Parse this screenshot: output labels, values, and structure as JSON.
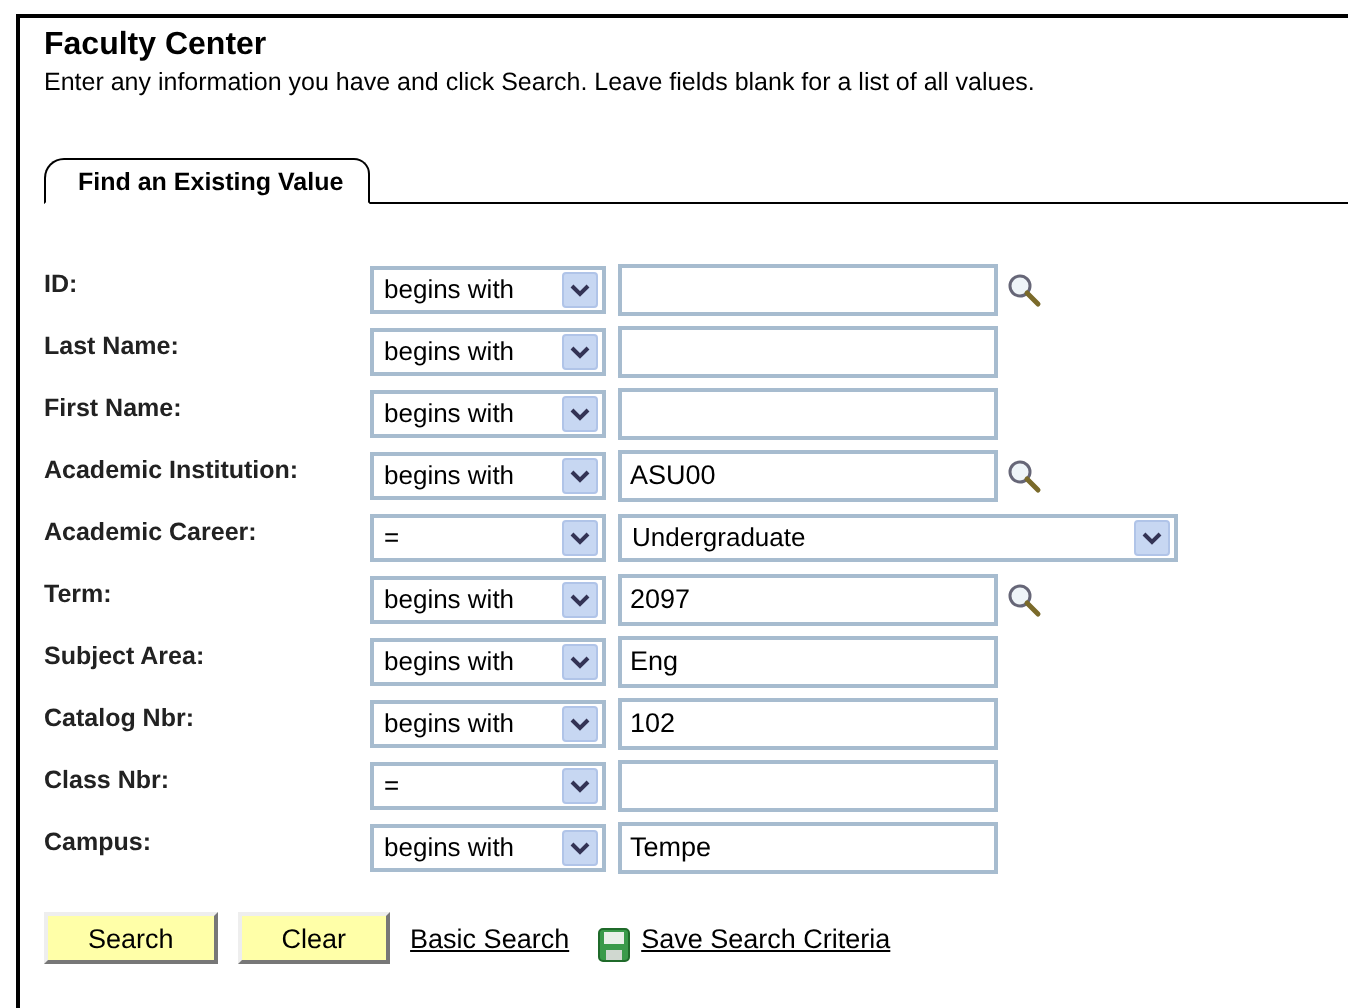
{
  "page": {
    "title": "Faculty Center",
    "instructions": "Enter any information you have and click Search. Leave fields blank for a list of all values."
  },
  "tabs": [
    {
      "label": "Find an Existing Value",
      "selected": true
    }
  ],
  "fields": [
    {
      "label": "ID:",
      "operator": "begins with",
      "kind": "text",
      "lookup": true
    },
    {
      "label": "Last Name:",
      "operator": "begins with",
      "kind": "text",
      "lookup": false
    },
    {
      "label": "First Name:",
      "operator": "begins with",
      "kind": "text",
      "lookup": false
    },
    {
      "label": "Academic Institution:",
      "operator": "begins with",
      "kind": "text",
      "value": "ASU00",
      "lookup": true
    },
    {
      "label": "Academic Career:",
      "operator": "=",
      "kind": "select",
      "value": "Undergraduate",
      "lookup": false
    },
    {
      "label": "Term:",
      "operator": "begins with",
      "kind": "text",
      "value": "2097",
      "lookup": true
    },
    {
      "label": "Subject Area:",
      "operator": "begins with",
      "kind": "text",
      "value": "Eng",
      "lookup": false
    },
    {
      "label": "Catalog Nbr:",
      "operator": "begins with",
      "kind": "text",
      "value": "102",
      "lookup": false
    },
    {
      "label": "Class Nbr:",
      "operator": "=",
      "kind": "text",
      "lookup": false
    },
    {
      "label": "Campus:",
      "operator": "begins with",
      "kind": "text",
      "value": "Tempe",
      "lookup": false
    }
  ],
  "actions": [
    {
      "kind": "button",
      "label": "Search"
    },
    {
      "kind": "button",
      "label": "Clear"
    },
    {
      "kind": "link",
      "label": "Basic Search"
    },
    {
      "kind": "save-link",
      "label": "Save Search Criteria"
    }
  ]
}
